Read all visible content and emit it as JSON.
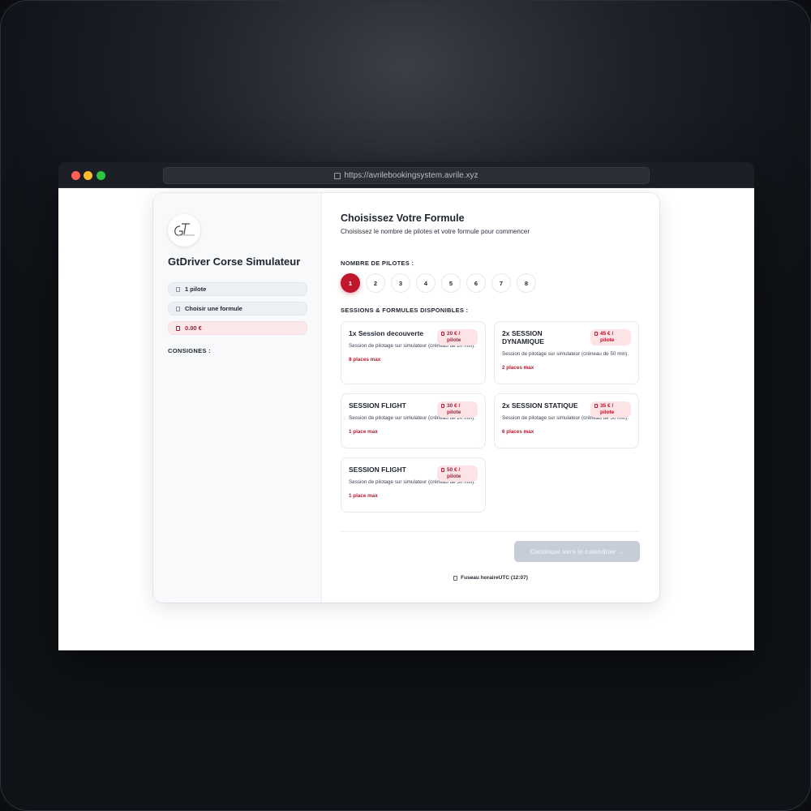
{
  "browser": {
    "url": "https://avrilebookingsystem.avrile.xyz"
  },
  "sidebar": {
    "company_name": "GtDriver Corse Simulateur",
    "pilots_summary": "1 pilote",
    "formula_summary": "Choisir une formule",
    "total": "0.00 €",
    "consignes_label": "CONSIGNES :"
  },
  "main": {
    "title": "Choisissez Votre Formule",
    "subtitle": "Choisissez le nombre de pilotes et votre formule pour commencer",
    "pilots_label": "NOMBRE DE PILOTES :",
    "pilots": [
      "1",
      "2",
      "3",
      "4",
      "5",
      "6",
      "7",
      "8"
    ],
    "selected_pilots": "1",
    "sessions_label": "SESSIONS & FORMULES DISPONIBLES :",
    "formulas": [
      {
        "name": "1x Session decouverte",
        "price": "20 € / pilote",
        "description": "Session de pilotage sur simulateur (créneau de 20 min).",
        "max": "8 places max"
      },
      {
        "name": "2x SESSION DYNAMIQUE",
        "price": "45 € / pilote",
        "description": "Session de pilotage sur simulateur (créneau de 50 min).",
        "max": "2 places max"
      },
      {
        "name": "SESSION FLIGHT",
        "price": "30 € / pilote",
        "description": "Session de pilotage sur simulateur (créneau de 20 min).",
        "max": "1 place max"
      },
      {
        "name": "2x SESSION STATIQUE",
        "price": "35 € / pilote",
        "description": "Session de pilotage sur simulateur (créneau de 50 min).",
        "max": "6 places max"
      },
      {
        "name": "SESSION FLIGHT",
        "price": "50 € / pilote",
        "description": "Session de pilotage sur simulateur (créneau de 30 min).",
        "max": "1 place max"
      }
    ],
    "continue_label": "Continuer vers le calendrier →",
    "timezone": "Fuseau horaireUTC (12:07)"
  },
  "colors": {
    "accent": "#c0172f",
    "accent_light": "#fbe3e6",
    "disabled_button": "#c4cdd8"
  }
}
